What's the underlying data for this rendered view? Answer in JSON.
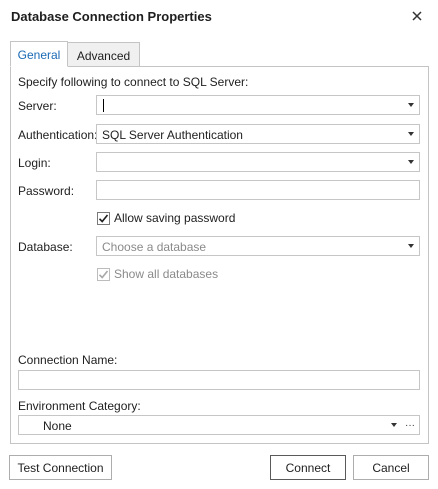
{
  "window": {
    "title": "Database Connection Properties"
  },
  "tabs": [
    {
      "label": "General"
    },
    {
      "label": "Advanced"
    }
  ],
  "form": {
    "intro": "Specify following to connect to SQL Server:",
    "server": {
      "label": "Server:",
      "value": ""
    },
    "authentication": {
      "label": "Authentication:",
      "value": "SQL Server Authentication"
    },
    "login": {
      "label": "Login:",
      "value": ""
    },
    "password": {
      "label": "Password:",
      "value": ""
    },
    "allow_saving_password": {
      "label": "Allow saving password",
      "checked": true
    },
    "database": {
      "label": "Database:",
      "placeholder": "Choose a database"
    },
    "show_all_databases": {
      "label": "Show all databases",
      "checked": true,
      "disabled": true
    },
    "connection_name": {
      "label": "Connection Name:",
      "value": ""
    },
    "environment_category": {
      "label": "Environment Category:",
      "value": "None",
      "more": "···"
    }
  },
  "buttons": {
    "test_connection": "Test Connection",
    "connect": "Connect",
    "cancel": "Cancel"
  },
  "colors": {
    "active_tab_text": "#1a6ab5",
    "border": "#c4c4c4",
    "disabled_text": "#8a8a8a"
  }
}
